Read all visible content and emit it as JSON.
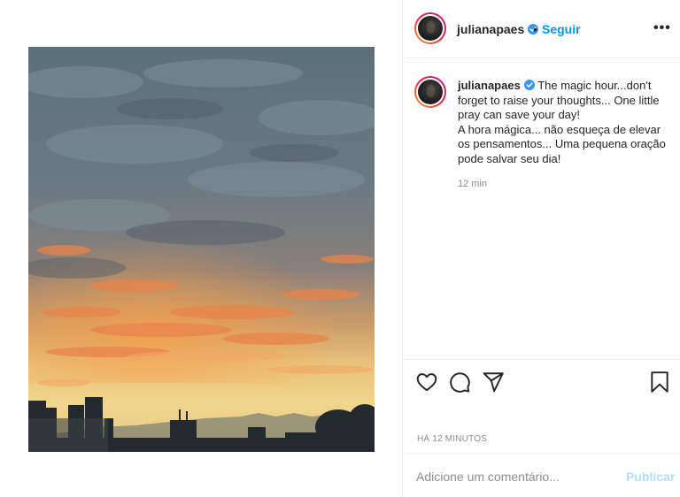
{
  "post": {
    "username": "julianapaes",
    "verified": true,
    "separator": "•",
    "follow_label": "Seguir",
    "more_label": "•••",
    "caption_lines": [
      "The magic hour...don't forget to raise your thoughts... One little pray can save your day!",
      "A hora mágica... não esqueça de elevar os pensamentos... Uma pequena oração pode salvar seu dia!"
    ],
    "caption_time": "12 min",
    "date_label": "HÁ 12 MINUTOS"
  },
  "comment": {
    "placeholder": "Adicione um comentário...",
    "publish_label": "Publicar"
  },
  "icons": {
    "like": "heart-icon",
    "comment": "comment-icon",
    "share": "share-icon",
    "save": "bookmark-icon",
    "verified": "verified-badge-icon"
  },
  "colors": {
    "link": "#0095f6",
    "publish_disabled": "#b2dffc",
    "verified": "#3897f0",
    "muted": "#8e8e8e"
  }
}
